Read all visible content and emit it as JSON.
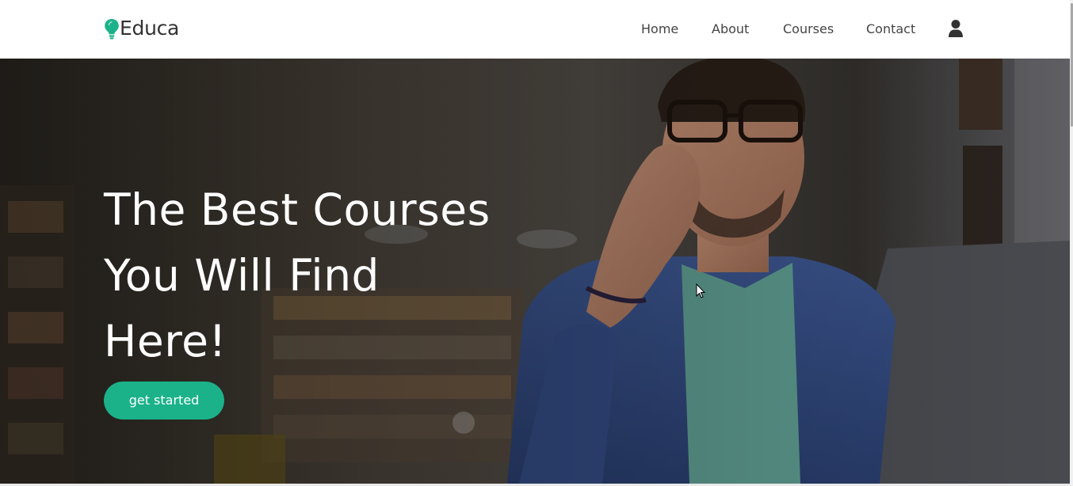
{
  "header": {
    "logo_text": "Educa",
    "nav": [
      {
        "label": "Home"
      },
      {
        "label": "About"
      },
      {
        "label": "Courses"
      },
      {
        "label": "Contact"
      }
    ],
    "logo_icon": "lightbulb-icon",
    "user_icon": "user-icon"
  },
  "hero": {
    "title_lines": [
      "The Best Courses",
      "You Will Find",
      "Here!"
    ],
    "cta_label": "get started"
  },
  "colors": {
    "accent": "#1bb28a",
    "nav_text": "#444444",
    "hero_text": "#ffffff"
  }
}
